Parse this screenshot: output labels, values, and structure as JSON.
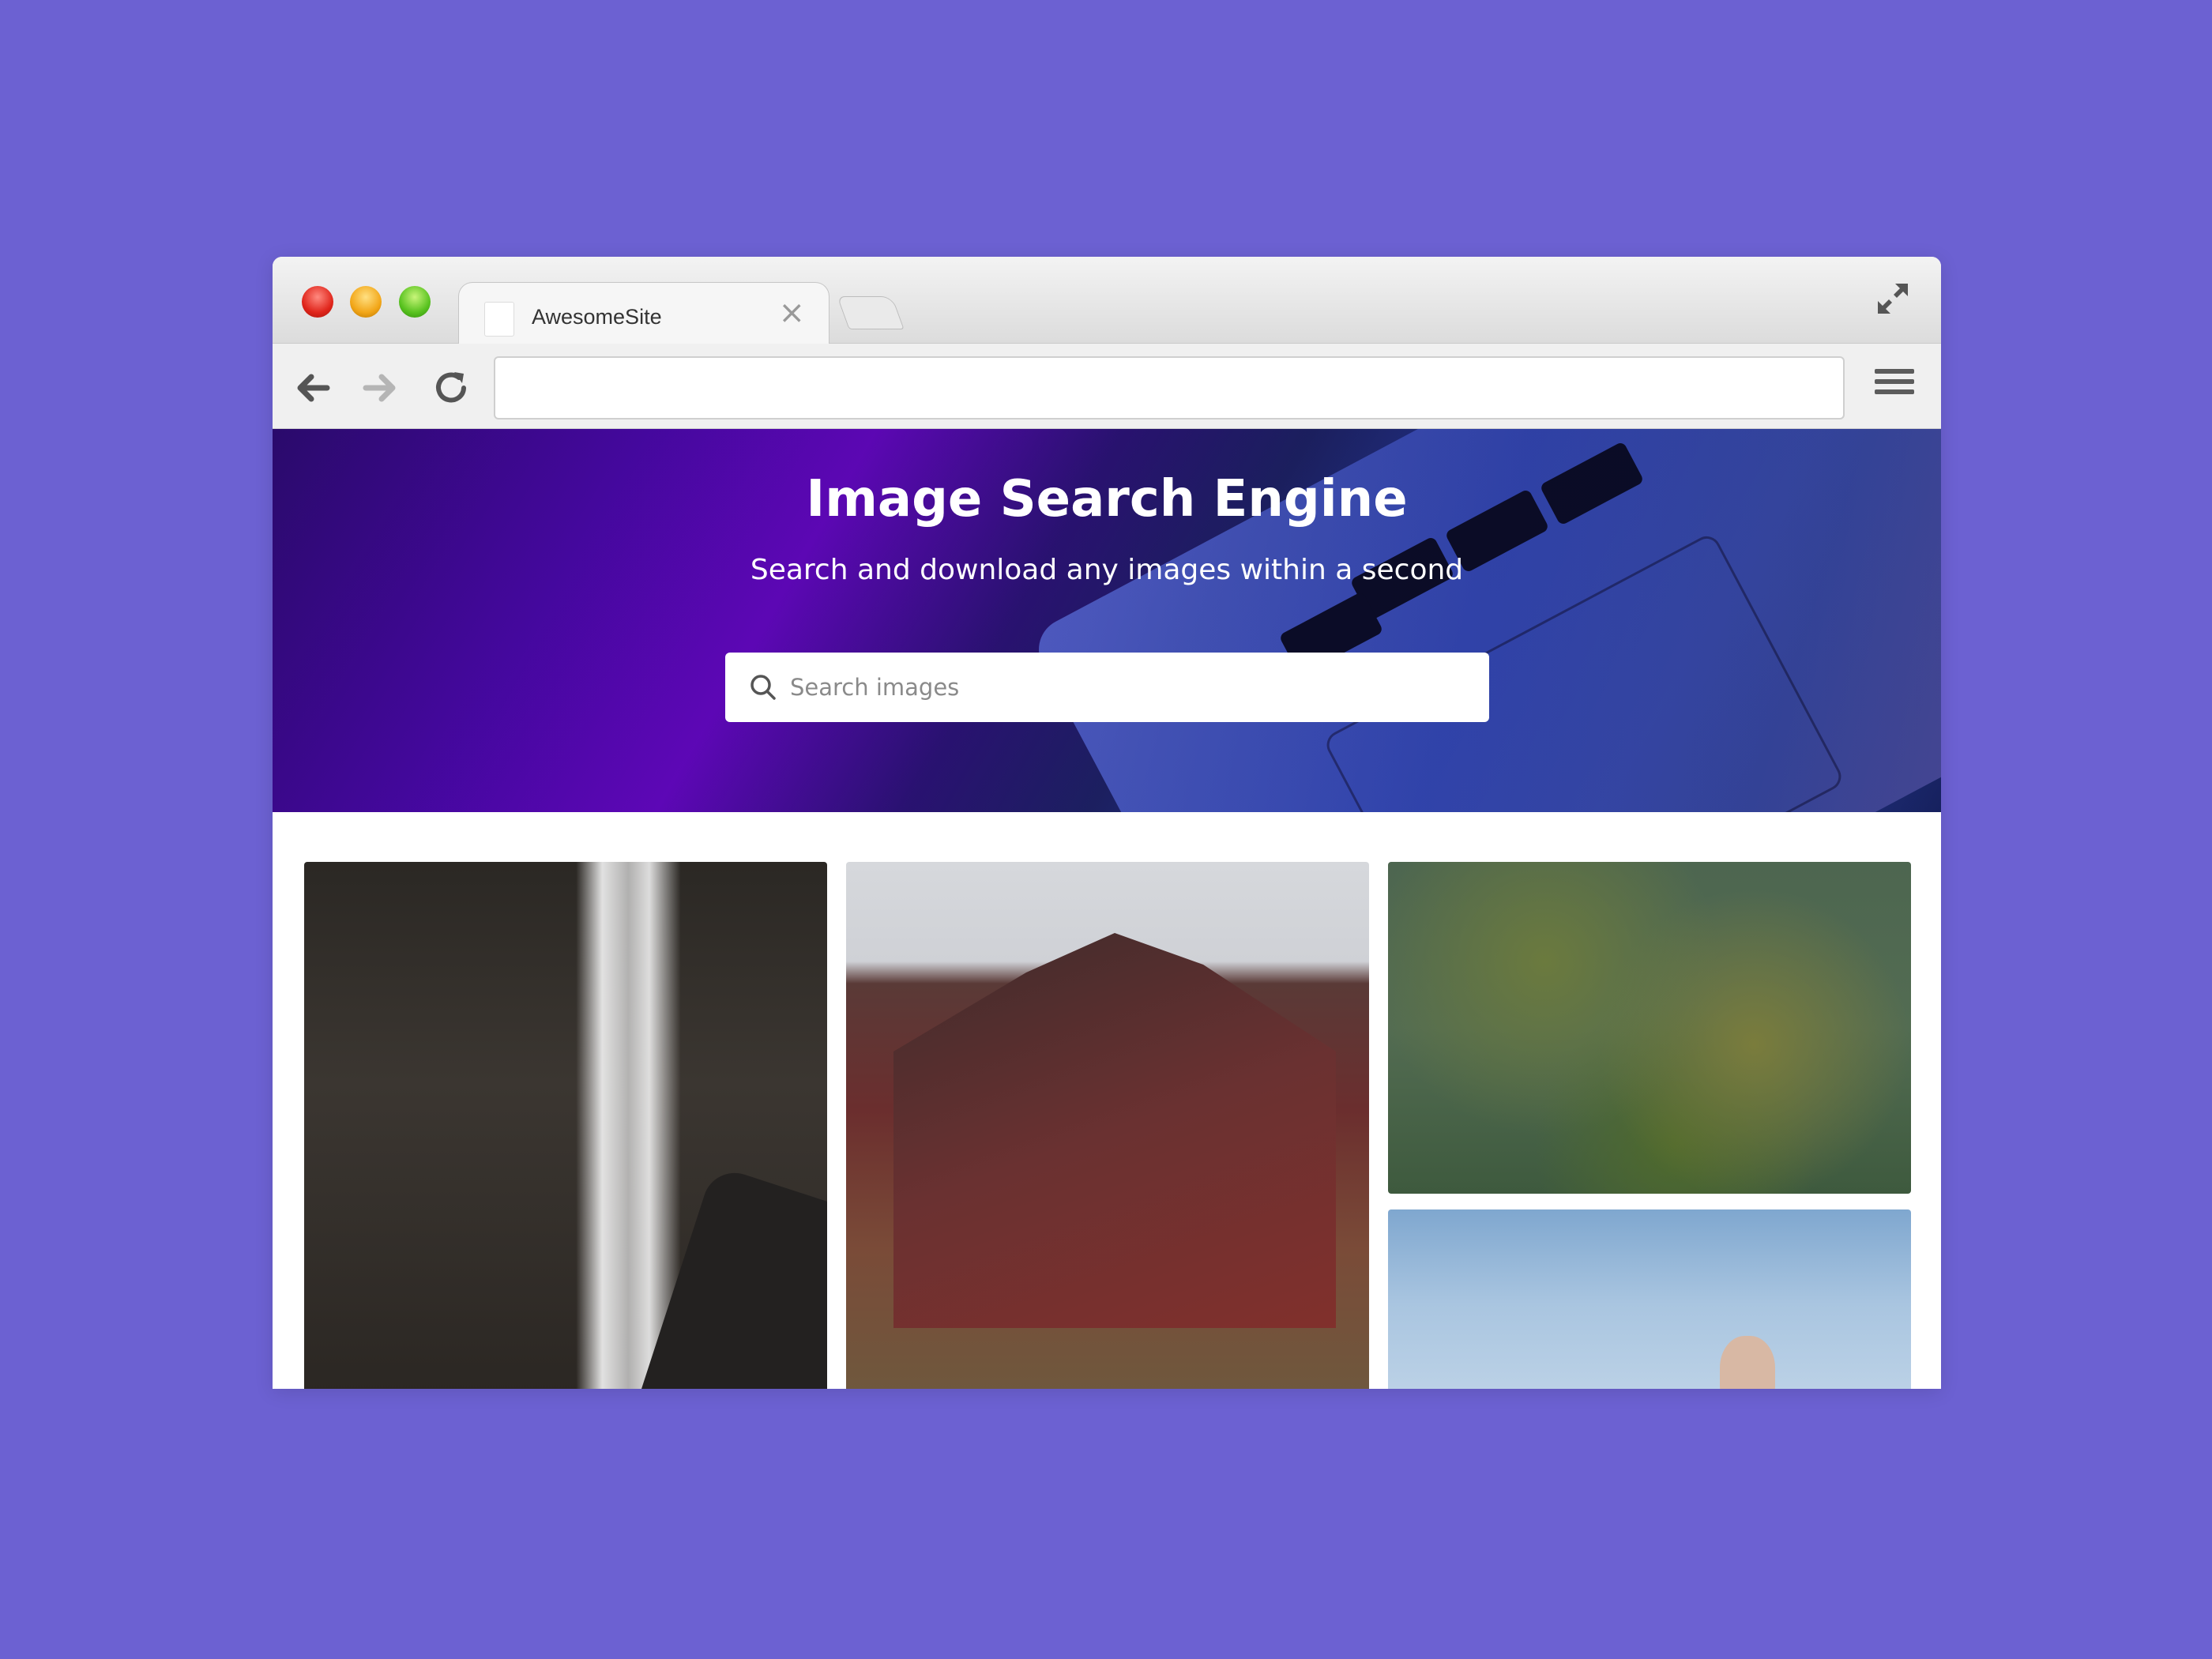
{
  "browser": {
    "tab_title": "AwesomeSite",
    "tab_close": "×",
    "url": ""
  },
  "hero": {
    "title": "Image Search Engine",
    "subtitle": "Search and download any images within a second",
    "search_placeholder": "Search images"
  },
  "gallery": {
    "images": [
      {
        "subject": "waterfall"
      },
      {
        "subject": "red mountain"
      },
      {
        "subject": "grassland aerial"
      },
      {
        "subject": "sky with person"
      }
    ]
  },
  "colors": {
    "background": "#6c61d2",
    "hero_accent": "#6607c4",
    "traffic_red": "#e0251b",
    "traffic_yellow": "#f2a618",
    "traffic_green": "#58c21f"
  }
}
